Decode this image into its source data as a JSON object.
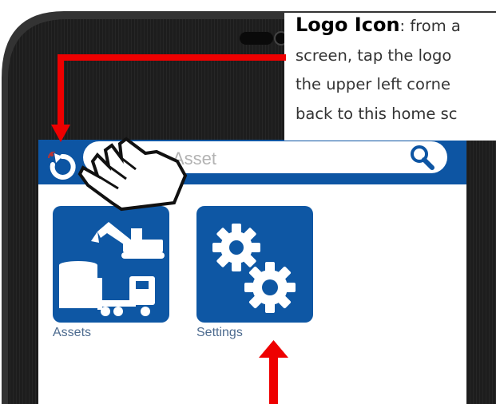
{
  "callout": {
    "title": "Logo Icon",
    "lines": [
      ": from a",
      "screen, tap the logo",
      "the upper left corne",
      "back to this home sc"
    ]
  },
  "search": {
    "placeholder": "Search Asset",
    "visible_text": "Asset"
  },
  "tiles": [
    {
      "label": "Assets",
      "icon": "assets-icon"
    },
    {
      "label": "Settings",
      "icon": "gears-icon"
    }
  ],
  "colors": {
    "brand": "#0e57a4",
    "annotation": "#ee0000",
    "device_bezel": "#1b1b1b"
  }
}
